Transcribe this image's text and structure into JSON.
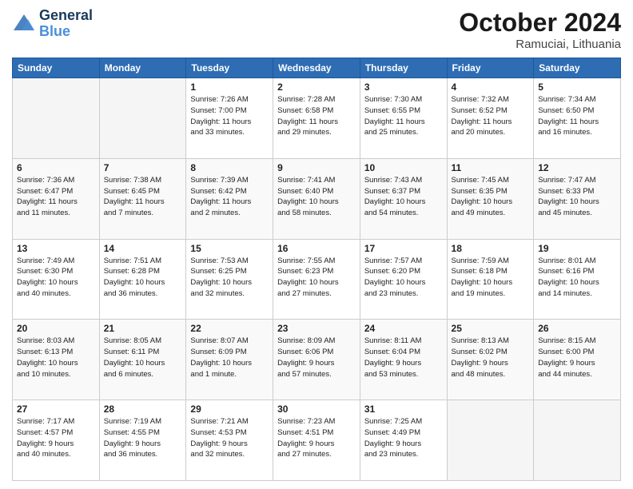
{
  "header": {
    "logo_line1": "General",
    "logo_line2": "Blue",
    "month": "October 2024",
    "location": "Ramuciai, Lithuania"
  },
  "weekdays": [
    "Sunday",
    "Monday",
    "Tuesday",
    "Wednesday",
    "Thursday",
    "Friday",
    "Saturday"
  ],
  "weeks": [
    [
      {
        "day": "",
        "info": ""
      },
      {
        "day": "",
        "info": ""
      },
      {
        "day": "1",
        "info": "Sunrise: 7:26 AM\nSunset: 7:00 PM\nDaylight: 11 hours\nand 33 minutes."
      },
      {
        "day": "2",
        "info": "Sunrise: 7:28 AM\nSunset: 6:58 PM\nDaylight: 11 hours\nand 29 minutes."
      },
      {
        "day": "3",
        "info": "Sunrise: 7:30 AM\nSunset: 6:55 PM\nDaylight: 11 hours\nand 25 minutes."
      },
      {
        "day": "4",
        "info": "Sunrise: 7:32 AM\nSunset: 6:52 PM\nDaylight: 11 hours\nand 20 minutes."
      },
      {
        "day": "5",
        "info": "Sunrise: 7:34 AM\nSunset: 6:50 PM\nDaylight: 11 hours\nand 16 minutes."
      }
    ],
    [
      {
        "day": "6",
        "info": "Sunrise: 7:36 AM\nSunset: 6:47 PM\nDaylight: 11 hours\nand 11 minutes."
      },
      {
        "day": "7",
        "info": "Sunrise: 7:38 AM\nSunset: 6:45 PM\nDaylight: 11 hours\nand 7 minutes."
      },
      {
        "day": "8",
        "info": "Sunrise: 7:39 AM\nSunset: 6:42 PM\nDaylight: 11 hours\nand 2 minutes."
      },
      {
        "day": "9",
        "info": "Sunrise: 7:41 AM\nSunset: 6:40 PM\nDaylight: 10 hours\nand 58 minutes."
      },
      {
        "day": "10",
        "info": "Sunrise: 7:43 AM\nSunset: 6:37 PM\nDaylight: 10 hours\nand 54 minutes."
      },
      {
        "day": "11",
        "info": "Sunrise: 7:45 AM\nSunset: 6:35 PM\nDaylight: 10 hours\nand 49 minutes."
      },
      {
        "day": "12",
        "info": "Sunrise: 7:47 AM\nSunset: 6:33 PM\nDaylight: 10 hours\nand 45 minutes."
      }
    ],
    [
      {
        "day": "13",
        "info": "Sunrise: 7:49 AM\nSunset: 6:30 PM\nDaylight: 10 hours\nand 40 minutes."
      },
      {
        "day": "14",
        "info": "Sunrise: 7:51 AM\nSunset: 6:28 PM\nDaylight: 10 hours\nand 36 minutes."
      },
      {
        "day": "15",
        "info": "Sunrise: 7:53 AM\nSunset: 6:25 PM\nDaylight: 10 hours\nand 32 minutes."
      },
      {
        "day": "16",
        "info": "Sunrise: 7:55 AM\nSunset: 6:23 PM\nDaylight: 10 hours\nand 27 minutes."
      },
      {
        "day": "17",
        "info": "Sunrise: 7:57 AM\nSunset: 6:20 PM\nDaylight: 10 hours\nand 23 minutes."
      },
      {
        "day": "18",
        "info": "Sunrise: 7:59 AM\nSunset: 6:18 PM\nDaylight: 10 hours\nand 19 minutes."
      },
      {
        "day": "19",
        "info": "Sunrise: 8:01 AM\nSunset: 6:16 PM\nDaylight: 10 hours\nand 14 minutes."
      }
    ],
    [
      {
        "day": "20",
        "info": "Sunrise: 8:03 AM\nSunset: 6:13 PM\nDaylight: 10 hours\nand 10 minutes."
      },
      {
        "day": "21",
        "info": "Sunrise: 8:05 AM\nSunset: 6:11 PM\nDaylight: 10 hours\nand 6 minutes."
      },
      {
        "day": "22",
        "info": "Sunrise: 8:07 AM\nSunset: 6:09 PM\nDaylight: 10 hours\nand 1 minute."
      },
      {
        "day": "23",
        "info": "Sunrise: 8:09 AM\nSunset: 6:06 PM\nDaylight: 9 hours\nand 57 minutes."
      },
      {
        "day": "24",
        "info": "Sunrise: 8:11 AM\nSunset: 6:04 PM\nDaylight: 9 hours\nand 53 minutes."
      },
      {
        "day": "25",
        "info": "Sunrise: 8:13 AM\nSunset: 6:02 PM\nDaylight: 9 hours\nand 48 minutes."
      },
      {
        "day": "26",
        "info": "Sunrise: 8:15 AM\nSunset: 6:00 PM\nDaylight: 9 hours\nand 44 minutes."
      }
    ],
    [
      {
        "day": "27",
        "info": "Sunrise: 7:17 AM\nSunset: 4:57 PM\nDaylight: 9 hours\nand 40 minutes."
      },
      {
        "day": "28",
        "info": "Sunrise: 7:19 AM\nSunset: 4:55 PM\nDaylight: 9 hours\nand 36 minutes."
      },
      {
        "day": "29",
        "info": "Sunrise: 7:21 AM\nSunset: 4:53 PM\nDaylight: 9 hours\nand 32 minutes."
      },
      {
        "day": "30",
        "info": "Sunrise: 7:23 AM\nSunset: 4:51 PM\nDaylight: 9 hours\nand 27 minutes."
      },
      {
        "day": "31",
        "info": "Sunrise: 7:25 AM\nSunset: 4:49 PM\nDaylight: 9 hours\nand 23 minutes."
      },
      {
        "day": "",
        "info": ""
      },
      {
        "day": "",
        "info": ""
      }
    ]
  ]
}
